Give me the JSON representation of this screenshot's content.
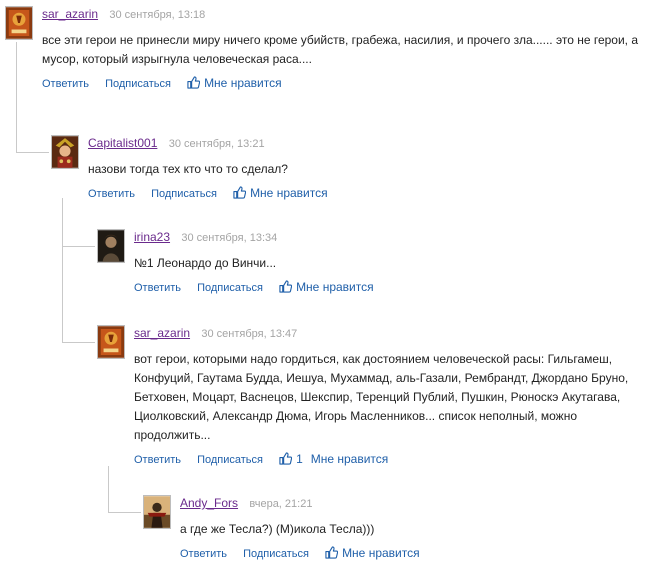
{
  "comments": [
    {
      "author": "sar_azarin",
      "date": "30 сентября, 13:18",
      "text": "все эти герои не принесли миру ничего кроме убийств, грабежа, насилия, и прочего зла...... это не герои, а мусор, который изрыгнула человеческая раса....",
      "reply": "Ответить",
      "subscribe": "Подписаться",
      "like": "Мне нравится",
      "likes": "",
      "avatar": "orange-emblem-avatar"
    },
    {
      "author": "Capitalist001",
      "date": "30 сентября, 13:21",
      "text": "назови тогда тех кто что то сделал?",
      "reply": "Ответить",
      "subscribe": "Подписаться",
      "like": "Мне нравится",
      "likes": "",
      "avatar": "jester-portrait-avatar"
    },
    {
      "author": "irina23",
      "date": "30 сентября, 13:34",
      "text": "№1 Леонардо до Винчи...",
      "reply": "Ответить",
      "subscribe": "Подписаться",
      "like": "Мне нравится",
      "likes": "",
      "avatar": "dark-portrait-avatar"
    },
    {
      "author": "sar_azarin",
      "date": "30 сентября, 13:47",
      "text": "вот герои, которыми надо гордиться, как достоянием человеческой расы: Гильгамеш, Конфуций, Гаутама Будда, Иешуа, Мухаммад, аль-Газали, Рембрандт, Джордано Бруно, Бетховен, Моцарт, Васнецов, Шекспир, Теренций Публий, Пушкин, Рюноскэ Акутагава, Циолковский, Александр Дюма, Игорь Масленников... список неполный, можно продолжить...",
      "reply": "Ответить",
      "subscribe": "Подписаться",
      "like": "Мне нравится",
      "likes": "1",
      "avatar": "orange-emblem-avatar"
    },
    {
      "author": "Andy_Fors",
      "date": "вчера, 21:21",
      "text": "а где же Тесла?) (М)икола Тесла)))",
      "reply": "Ответить",
      "subscribe": "Подписаться",
      "like": "Мне нравится",
      "likes": "",
      "avatar": "warrior-avatar"
    }
  ],
  "colors": {
    "author": "#6a2a8c",
    "link": "#1f5fa9",
    "date": "#a4a4a4",
    "line": "#c9c9c9"
  }
}
